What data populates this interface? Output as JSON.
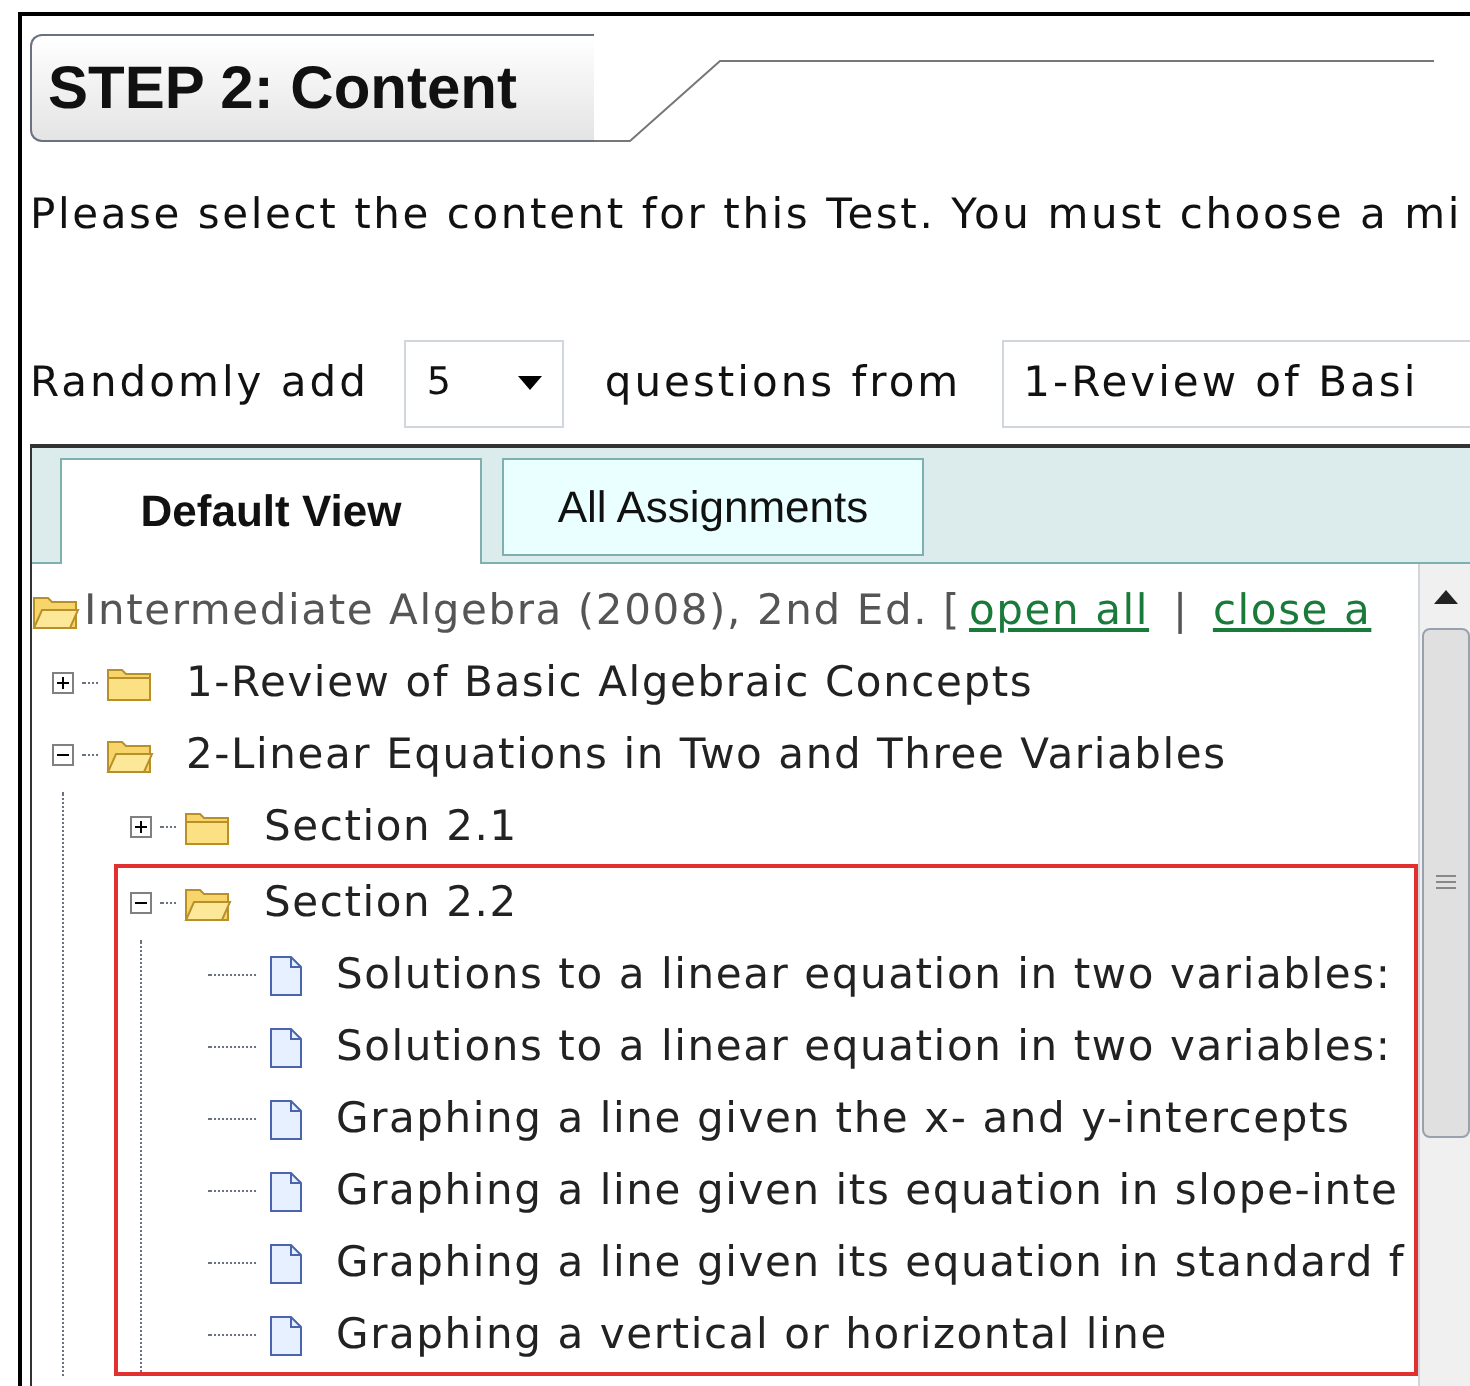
{
  "header": {
    "title": "STEP 2: Content"
  },
  "instructions": "Please select the content for this Test. You must choose a mi",
  "random_add": {
    "label_before": "Randomly add",
    "count": "5",
    "label_after": "questions from",
    "source": "1-Review of Basi"
  },
  "tabs": [
    {
      "label": "Default View",
      "selected": true
    },
    {
      "label": "All Assignments",
      "selected": false
    }
  ],
  "tree": {
    "root": {
      "label": "Intermediate Algebra (2008), 2nd Ed. [",
      "links": [
        "open all",
        "close a"
      ],
      "separator": "|"
    },
    "items": [
      {
        "label": "1-Review of Basic Algebraic Concepts",
        "kind": "folder",
        "expanded": false,
        "selected": false
      },
      {
        "label": "2-Linear Equations in Two and Three Variables",
        "kind": "folder",
        "expanded": true,
        "selected": false,
        "children": [
          {
            "label": "Section 2.1",
            "kind": "folder",
            "expanded": false,
            "selected": false
          },
          {
            "label": "Section 2.2",
            "kind": "folder",
            "expanded": true,
            "selected": true,
            "children": [
              {
                "label": "Solutions to a linear equation in two variables:",
                "kind": "page",
                "selected": false
              },
              {
                "label": "Solutions to a linear equation in two variables:",
                "kind": "page",
                "selected": false
              },
              {
                "label": "Graphing a line given the x- and y-intercepts",
                "kind": "page",
                "selected": false
              },
              {
                "label": "Graphing a line given its equation in slope-inte",
                "kind": "page",
                "selected": false
              },
              {
                "label": "Graphing a line given its equation in standard f",
                "kind": "page",
                "selected": false
              },
              {
                "label": "Graphing a vertical or horizontal line",
                "kind": "page",
                "selected": false
              }
            ]
          }
        ]
      }
    ]
  }
}
